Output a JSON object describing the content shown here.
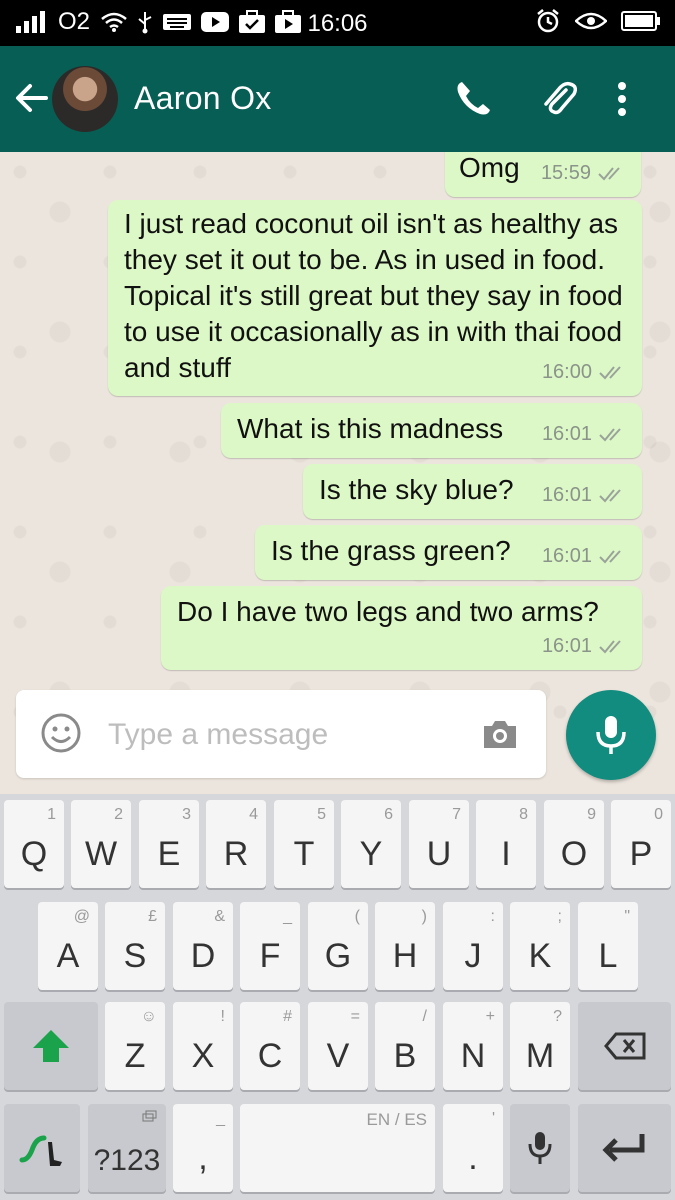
{
  "status_bar": {
    "carrier": "O2",
    "time": "16:06",
    "icons": [
      "signal-icon",
      "wifi-icon",
      "usb-icon",
      "keyboard-icon",
      "youtube-icon",
      "briefcase-check-icon",
      "briefcase-play-icon",
      "alarm-icon",
      "eye-icon",
      "battery-icon"
    ]
  },
  "header": {
    "contact_name": "Aaron Ox",
    "icons": [
      "back-arrow-icon",
      "phone-icon",
      "attach-icon",
      "more-vert-icon"
    ],
    "color": "#075e54"
  },
  "messages": [
    {
      "text": "Omg",
      "time": "15:59"
    },
    {
      "text": "I just read coconut oil isn't as healthy as they set it out to be. As in used in food. Topical it's still great but they say in food to use it occasionally as in with thai food and stuff",
      "time": "16:00"
    },
    {
      "text": "What is this madness",
      "time": "16:01"
    },
    {
      "text": "Is the sky blue?",
      "time": "16:01"
    },
    {
      "text": "Is the grass green?",
      "time": "16:01"
    },
    {
      "text": "Do I have two legs and two arms?",
      "time": "16:01"
    }
  ],
  "composer": {
    "placeholder": "Type a message",
    "icons": [
      "emoji-icon",
      "camera-icon",
      "mic-icon"
    ]
  },
  "keyboard": {
    "row1": [
      {
        "main": "Q",
        "sup": "1"
      },
      {
        "main": "W",
        "sup": "2"
      },
      {
        "main": "E",
        "sup": "3"
      },
      {
        "main": "R",
        "sup": "4"
      },
      {
        "main": "T",
        "sup": "5"
      },
      {
        "main": "Y",
        "sup": "6"
      },
      {
        "main": "U",
        "sup": "7"
      },
      {
        "main": "I",
        "sup": "8"
      },
      {
        "main": "O",
        "sup": "9"
      },
      {
        "main": "P",
        "sup": "0"
      }
    ],
    "row2": [
      {
        "main": "A",
        "sup": "@"
      },
      {
        "main": "S",
        "sup": "£"
      },
      {
        "main": "D",
        "sup": "&"
      },
      {
        "main": "F",
        "sup": "_"
      },
      {
        "main": "G",
        "sup": "("
      },
      {
        "main": "H",
        "sup": ")"
      },
      {
        "main": "J",
        "sup": ":"
      },
      {
        "main": "K",
        "sup": ";"
      },
      {
        "main": "L",
        "sup": "\""
      }
    ],
    "row3": [
      {
        "main": "Z",
        "sup": "!"
      },
      {
        "main": "X",
        "sup": "#"
      },
      {
        "main": "C",
        "sup": "="
      },
      {
        "main": "V",
        "sup": "/"
      },
      {
        "main": "B",
        "sup": "+"
      },
      {
        "main": "N",
        "sup": "?"
      },
      {
        "main": "M",
        "sup": ""
      }
    ],
    "symbols_label": "?123",
    "comma_label": ",",
    "comma_sup": "_",
    "space_label": "EN / ES",
    "period_label": ".",
    "period_sup": "'",
    "m_sup": "?",
    "z_sup": "☺",
    "x_sup": "!"
  },
  "colors": {
    "bubble_out": "#dcf8c6",
    "accent": "#128c7e",
    "shift_green": "#1aa34a"
  }
}
